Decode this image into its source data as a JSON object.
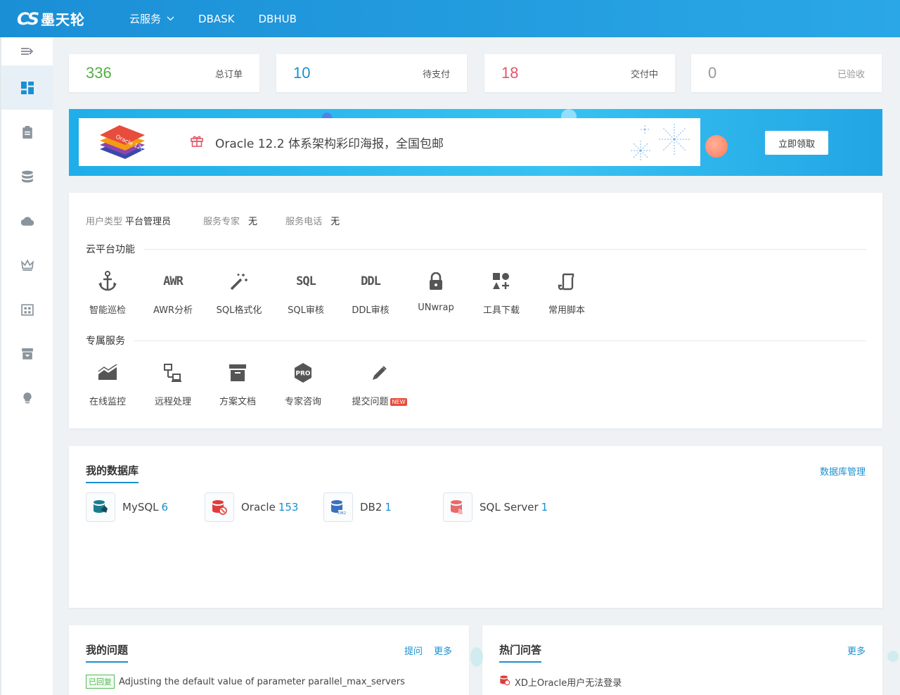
{
  "brand": {
    "logo_mark": "CS",
    "name": "墨天轮"
  },
  "nav": [
    {
      "label": "云服务",
      "has_dropdown": true
    },
    {
      "label": "DBASK",
      "has_dropdown": false
    },
    {
      "label": "DBHUB",
      "has_dropdown": false
    }
  ],
  "sidebar": {
    "toggle_icon": "menu-expand-icon",
    "items": [
      {
        "icon": "dashboard-icon",
        "active": true
      },
      {
        "icon": "clipboard-icon",
        "active": false
      },
      {
        "icon": "database-icon",
        "active": false
      },
      {
        "icon": "cloud-icon",
        "active": false
      },
      {
        "icon": "crown-icon",
        "active": false
      },
      {
        "icon": "calendar-grid-icon",
        "active": false
      },
      {
        "icon": "archive-icon",
        "active": false
      },
      {
        "icon": "lightbulb-icon",
        "active": false
      }
    ]
  },
  "stats": [
    {
      "value": "336",
      "label": "总订单",
      "color": "#52b043"
    },
    {
      "value": "10",
      "label": "待支付",
      "color": "#1a8fd1"
    },
    {
      "value": "18",
      "label": "交付中",
      "color": "#e5566a"
    },
    {
      "value": "0",
      "label": "已验收",
      "color": "#999999"
    }
  ],
  "banner": {
    "text": "Oracle 12.2 体系架构彩印海报，全国包邮",
    "button": "立即领取",
    "poster_label": "Oracle 12c"
  },
  "user_info": {
    "type_key": "用户类型",
    "type_value": "平台管理员",
    "expert_key": "服务专家",
    "expert_value": "无",
    "phone_key": "服务电话",
    "phone_value": "无"
  },
  "cloud_functions": {
    "title": "云平台功能",
    "items": [
      {
        "label": "智能巡检",
        "icon": "anchor-icon"
      },
      {
        "label": "AWR分析",
        "icon": "awr-icon",
        "glyph": "AWR"
      },
      {
        "label": "SQL格式化",
        "icon": "magic-wand-icon"
      },
      {
        "label": "SQL审核",
        "icon": "sql-icon",
        "glyph": "SQL"
      },
      {
        "label": "DDL审核",
        "icon": "ddl-icon",
        "glyph": "DDL"
      },
      {
        "label": "UNwrap",
        "icon": "lock-icon"
      },
      {
        "label": "工具下载",
        "icon": "shapes-icon"
      },
      {
        "label": "常用脚本",
        "icon": "script-icon"
      }
    ]
  },
  "exclusive_services": {
    "title": "专属服务",
    "items": [
      {
        "label": "在线监控",
        "icon": "area-chart-icon"
      },
      {
        "label": "远程处理",
        "icon": "remote-icon"
      },
      {
        "label": "方案文档",
        "icon": "archive-box-icon"
      },
      {
        "label": "专家咨询",
        "icon": "pro-badge-icon",
        "glyph": "PRO"
      },
      {
        "label": "提交问题",
        "icon": "pencil-icon",
        "badge": "NEW"
      }
    ]
  },
  "my_databases": {
    "title": "我的数据库",
    "manage_link": "数据库管理",
    "items": [
      {
        "name": "MySQL",
        "count": "6",
        "icon": "mysql-icon",
        "color": "#1a7d8f"
      },
      {
        "name": "Oracle",
        "count": "153",
        "icon": "oracle-icon",
        "color": "#e03c3c"
      },
      {
        "name": "DB2",
        "count": "1",
        "icon": "db2-icon",
        "color": "#3b6fbf"
      },
      {
        "name": "SQL Server",
        "count": "1",
        "icon": "sqlserver-icon",
        "color": "#e86a6a"
      }
    ]
  },
  "my_questions": {
    "title": "我的问题",
    "ask_link": "提问",
    "more_link": "更多",
    "items": [
      {
        "tag": "已回复",
        "text": "Adjusting the default value of parameter parallel_max_servers"
      }
    ]
  },
  "hot_qa": {
    "title": "热门问答",
    "more_link": "更多",
    "items": [
      {
        "text": "XD上Oracle用户无法登录"
      }
    ]
  }
}
